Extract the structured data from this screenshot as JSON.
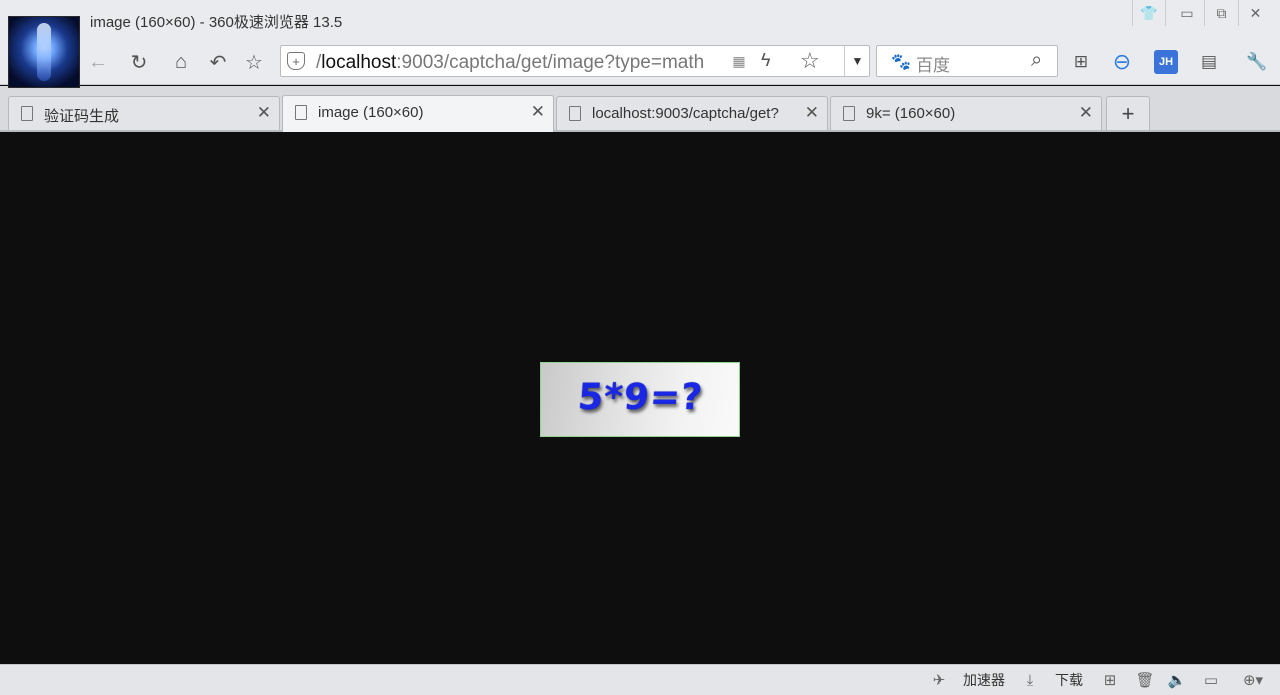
{
  "window": {
    "title": "image (160×60) - 360极速浏览器 13.5",
    "controls": {
      "skin": "👕",
      "minimize": "▭",
      "restore": "⧉",
      "close": "✕"
    }
  },
  "toolbar": {
    "back": "←",
    "refresh": "↻",
    "home": "⌂",
    "undo": "↶",
    "favorite": "☆",
    "address": {
      "prefix": "/",
      "host": "localhost",
      "rest": ":9003/captcha/get/image?type=math",
      "qr": "▦",
      "bolt": "ϟ",
      "star": "☆",
      "dropdown": "▼"
    },
    "search": {
      "engine_icon": "🐾",
      "placeholder": "百度",
      "icon": "⌕"
    },
    "extensions": [
      {
        "name": "apps-grid-icon",
        "glyph": "⊞"
      },
      {
        "name": "adblock-icon",
        "glyph": "⊖"
      },
      {
        "name": "jh-icon",
        "glyph": "JH"
      },
      {
        "name": "notes-icon",
        "glyph": "▤"
      },
      {
        "name": "tools-icon",
        "glyph": "🔧"
      }
    ]
  },
  "tabs": [
    {
      "label": "验证码生成",
      "close": "✕",
      "active": false
    },
    {
      "label": "image (160×60)",
      "close": "✕",
      "active": true
    },
    {
      "label": "localhost:9003/captcha/get?",
      "close": "✕",
      "active": false
    },
    {
      "label": "9k= (160×60)",
      "close": "✕",
      "active": false
    }
  ],
  "new_tab": "+",
  "content": {
    "captcha_text": "5*9=?"
  },
  "statusbar": {
    "accelerator_label": "加速器",
    "download_label": "下载"
  }
}
